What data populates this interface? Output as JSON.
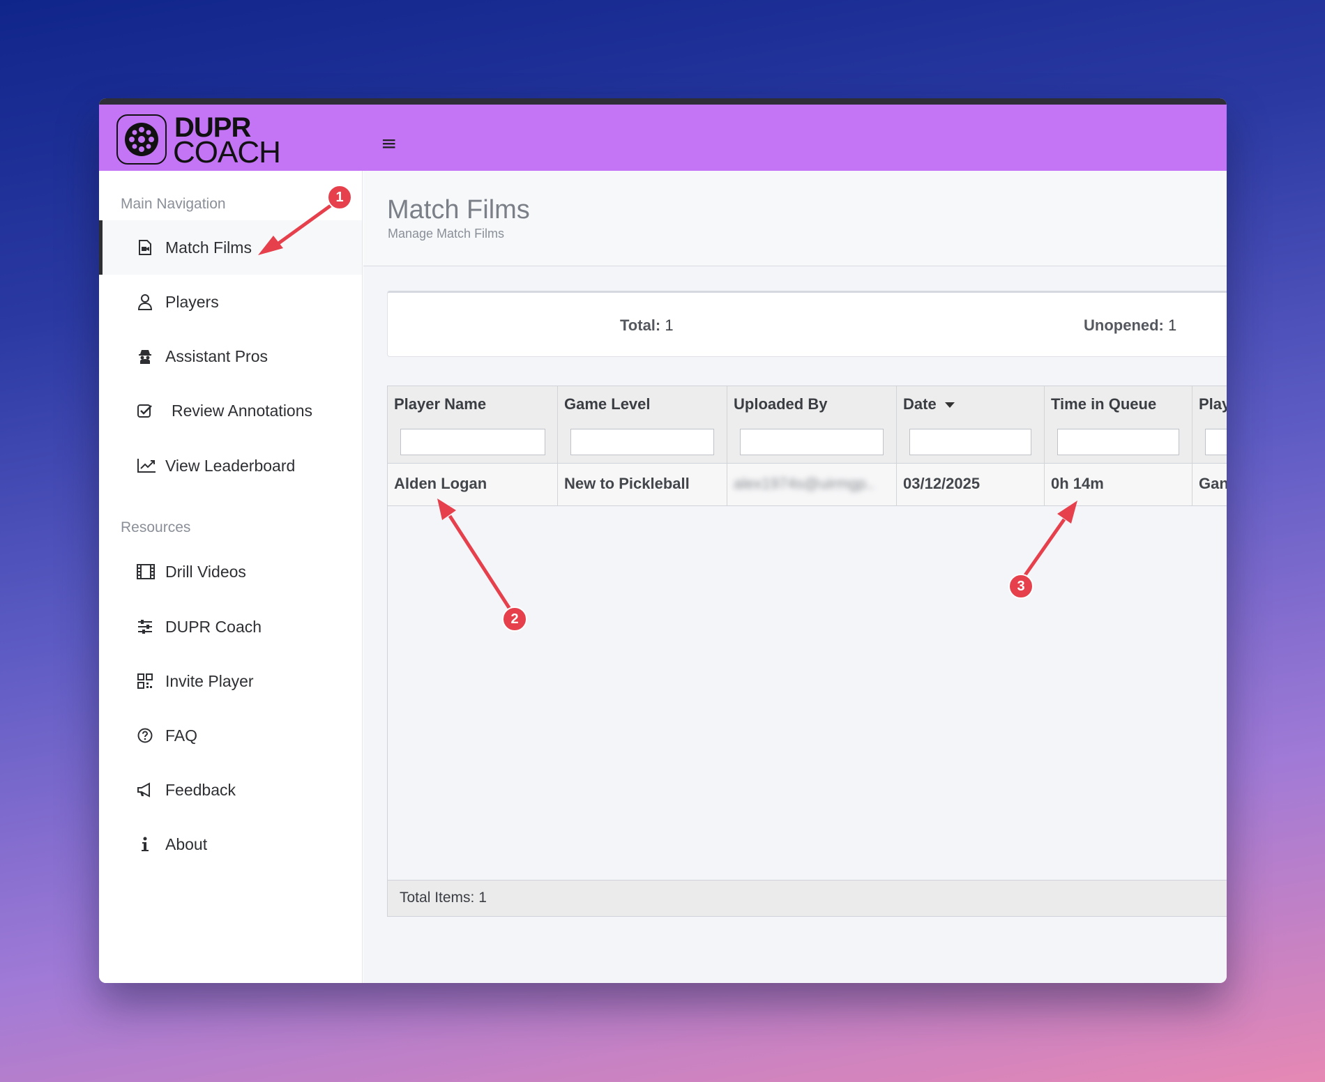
{
  "app": {
    "logo_top": "DUPR",
    "logo_bottom": "COACH",
    "menu_icon": "hamburger-icon"
  },
  "sidebar": {
    "main_section_label": "Main Navigation",
    "resources_section_label": "Resources",
    "main_items": [
      {
        "label": "Match Films",
        "icon": "video-file-icon",
        "active": true
      },
      {
        "label": "Players",
        "icon": "user-icon"
      },
      {
        "label": "Assistant Pros",
        "icon": "spy-icon"
      },
      {
        "label": "Review Annotations",
        "icon": "checkbox-icon"
      },
      {
        "label": "View Leaderboard",
        "icon": "line-chart-icon"
      }
    ],
    "resource_items": [
      {
        "label": "Drill Videos",
        "icon": "film-icon"
      },
      {
        "label": "DUPR Coach",
        "icon": "sliders-icon"
      },
      {
        "label": "Invite Player",
        "icon": "qr-code-icon"
      },
      {
        "label": "FAQ",
        "icon": "question-circle-icon"
      },
      {
        "label": "Feedback",
        "icon": "megaphone-icon"
      },
      {
        "label": "About",
        "icon": "info-icon"
      }
    ]
  },
  "page": {
    "title": "Match Films",
    "subtitle": "Manage Match Films"
  },
  "stats": {
    "total_label": "Total:",
    "total_value": "1",
    "unopened_label": "Unopened:",
    "unopened_value": "1"
  },
  "table": {
    "columns": [
      "Player Name",
      "Game Level",
      "Uploaded By",
      "Date",
      "Time in Queue",
      "Play"
    ],
    "sorted_column": "Date",
    "rows": [
      {
        "player_name": "Alden Logan",
        "game_level": "New to Pickleball",
        "uploaded_by": "alex1974s@uirmgp..",
        "date": "03/12/2025",
        "time_in_queue": "0h 14m",
        "play": "Gan"
      }
    ],
    "footer": "Total Items: 1"
  },
  "annotations": {
    "badge_1": "1",
    "badge_2": "2",
    "badge_3": "3",
    "color": "#e5404b"
  },
  "colors": {
    "header": "#c475f5",
    "sidebar_active_border": "#2d2f33"
  }
}
